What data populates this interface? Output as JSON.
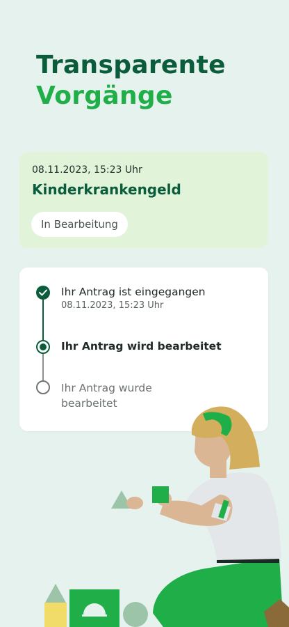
{
  "header": {
    "title_line1": "Transparente",
    "title_line2": "Vorgänge"
  },
  "case": {
    "date": "08.11.2023, 15:23 Uhr",
    "name": "Kinderkrankengeld",
    "status": "In Bearbeitung"
  },
  "timeline": {
    "steps": [
      {
        "label": "Ihr Antrag ist eingegangen",
        "date": "08.11.2023, 15:23 Uhr",
        "state": "done"
      },
      {
        "label": "Ihr Antrag wird bearbeitet",
        "state": "active"
      },
      {
        "label": "Ihr Antrag wurde bearbeitet",
        "state": "pending"
      }
    ]
  },
  "colors": {
    "dark_green": "#0a5c3a",
    "bright_green": "#1fae48",
    "background": "#e6f2ee",
    "card_green": "#e1f4d9"
  },
  "icons": {
    "done": "check-icon",
    "active": "radio-filled-icon",
    "pending": "radio-empty-icon"
  }
}
